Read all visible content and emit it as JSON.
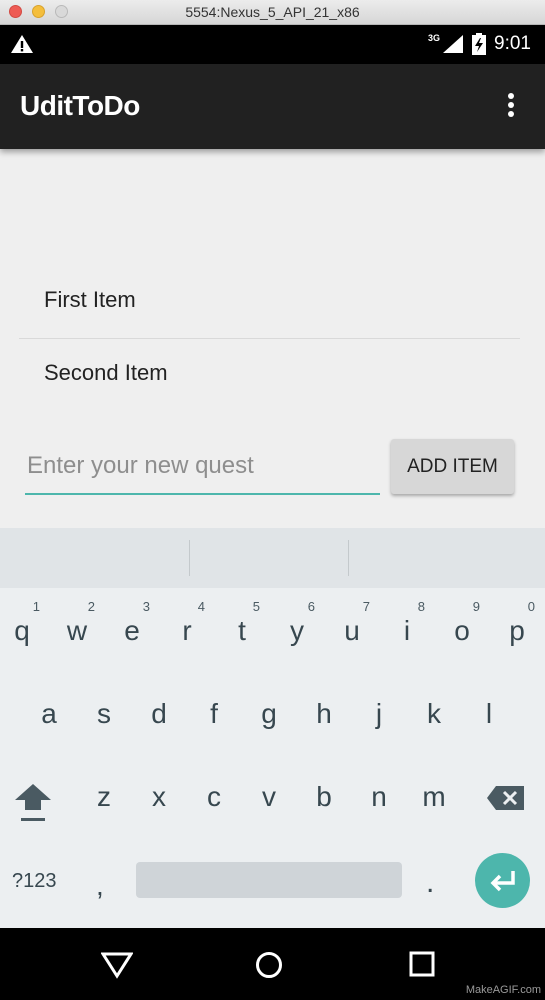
{
  "window": {
    "title": "5554:Nexus_5_API_21_x86"
  },
  "status_bar": {
    "network": "3G",
    "time": "9:01",
    "icons": [
      "warning-icon",
      "signal-icon",
      "battery-icon"
    ]
  },
  "app_bar": {
    "title": "UditToDo",
    "overflow_icon": "more-vert-icon"
  },
  "list": {
    "items": [
      "First Item",
      "Second Item"
    ]
  },
  "input": {
    "value": "",
    "placeholder": "Enter your new quest"
  },
  "add_button": {
    "label": "ADD ITEM"
  },
  "keyboard": {
    "row1": [
      "q",
      "w",
      "e",
      "r",
      "t",
      "y",
      "u",
      "i",
      "o",
      "p"
    ],
    "row1_hints": [
      "1",
      "2",
      "3",
      "4",
      "5",
      "6",
      "7",
      "8",
      "9",
      "0"
    ],
    "row2": [
      "a",
      "s",
      "d",
      "f",
      "g",
      "h",
      "j",
      "k",
      "l"
    ],
    "row3": [
      "z",
      "x",
      "c",
      "v",
      "b",
      "n",
      "m"
    ],
    "symbols_label": "?123",
    "comma": ",",
    "period": "."
  },
  "colors": {
    "accent": "#4db6ac",
    "app_bar": "#212121",
    "content_bg": "#efefef",
    "keyboard_bg": "#eceff1"
  },
  "watermark": "MakeAGIF.com"
}
